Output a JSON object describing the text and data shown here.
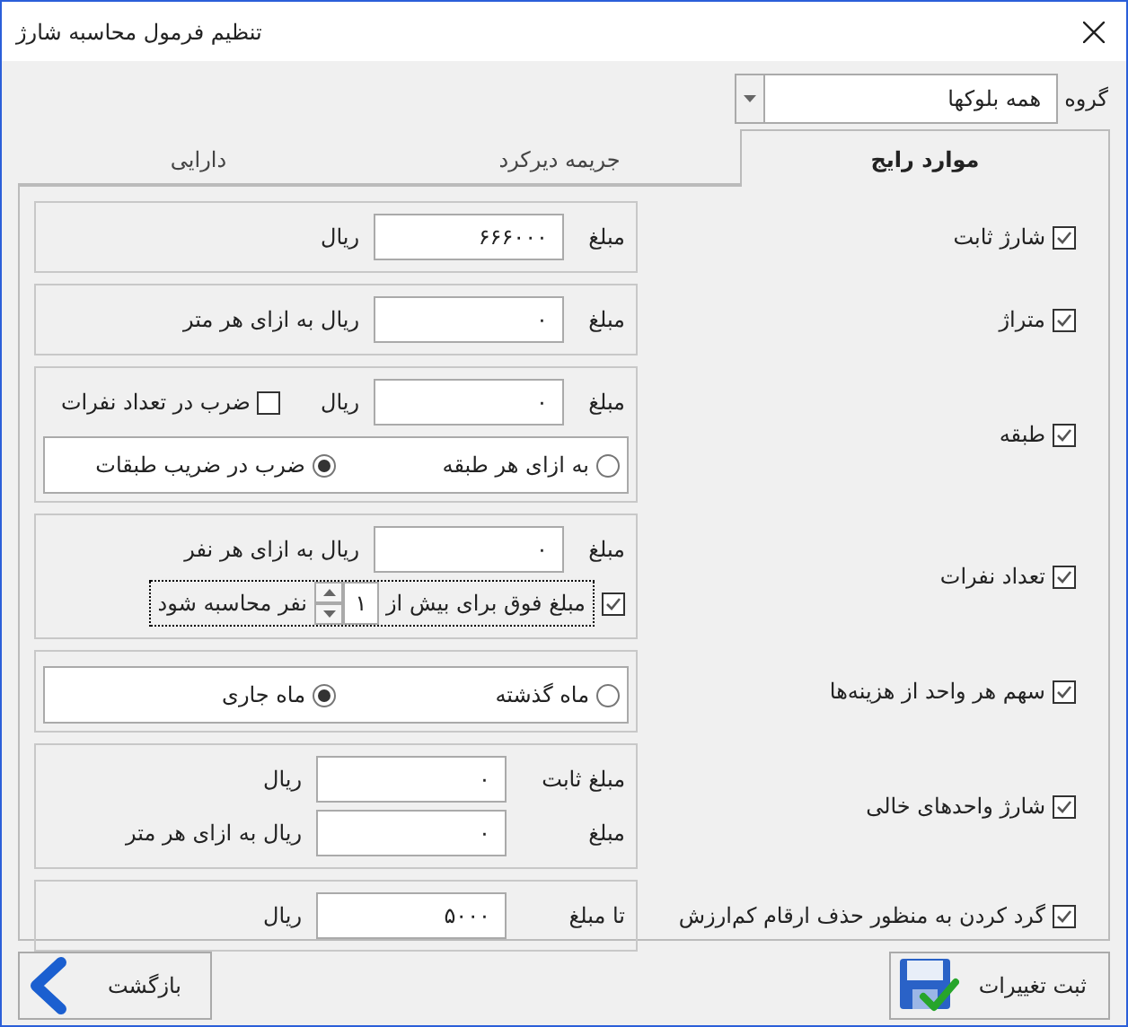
{
  "window": {
    "title": "تنظیم فرمول محاسبه شارژ"
  },
  "group": {
    "label": "گروه",
    "value": "همه بلوکها"
  },
  "tabs": [
    {
      "label": "موارد رایج",
      "selected": true
    },
    {
      "label": "جریمه دیرکرد",
      "selected": false
    },
    {
      "label": "دارایی",
      "selected": false
    }
  ],
  "rows": [
    {
      "label": "شارژ ثابت",
      "checked": true,
      "lines": [
        {
          "kind": "amount",
          "label": "مبلغ",
          "value": "۶۶۶۰۰۰",
          "unit": "ریال"
        }
      ]
    },
    {
      "label": "متراژ",
      "checked": true,
      "lines": [
        {
          "kind": "amount",
          "label": "مبلغ",
          "value": "۰",
          "unit": "ریال به ازای هر متر"
        }
      ]
    },
    {
      "label": "طبقه",
      "checked": true,
      "lines": [
        {
          "kind": "amount",
          "label": "مبلغ",
          "value": "۰",
          "unit": "ریال",
          "check": {
            "label": "ضرب در تعداد نفرات",
            "checked": false
          }
        },
        {
          "kind": "radios",
          "options": [
            {
              "label": "به ازای هر طبقه",
              "selected": false
            },
            {
              "label": "ضرب در ضریب طبقات",
              "selected": true
            }
          ]
        }
      ]
    },
    {
      "label": "تعداد نفرات",
      "checked": true,
      "lines": [
        {
          "kind": "amount",
          "label": "مبلغ",
          "value": "۰",
          "unit": "ریال به ازای هر نفر"
        },
        {
          "kind": "threshold",
          "checked": true,
          "before": "مبلغ فوق برای بیش از",
          "value": "۱",
          "after": "نفر محاسبه شود"
        }
      ]
    },
    {
      "label": "سهم هر واحد از هزینه‌ها",
      "checked": true,
      "lines": [
        {
          "kind": "radios",
          "options": [
            {
              "label": "ماه گذشته",
              "selected": false
            },
            {
              "label": "ماه جاری",
              "selected": true
            }
          ]
        }
      ]
    },
    {
      "label": "شارژ واحدهای خالی",
      "checked": true,
      "lines": [
        {
          "kind": "amount",
          "label": "مبلغ ثابت",
          "value": "۰",
          "unit": "ریال"
        },
        {
          "kind": "amount",
          "label": "مبلغ",
          "value": "۰",
          "unit": "ریال به ازای هر متر"
        }
      ]
    },
    {
      "label": "گرد کردن به منظور حذف ارقام کم‌ارزش",
      "checked": true,
      "lines": [
        {
          "kind": "amount",
          "label": "تا مبلغ",
          "value": "۵۰۰۰",
          "unit": "ریال"
        }
      ]
    }
  ],
  "buttons": [
    {
      "kind": "save",
      "label": "ثبت تغییرات"
    },
    {
      "kind": "back",
      "label": "بازگشت"
    }
  ]
}
